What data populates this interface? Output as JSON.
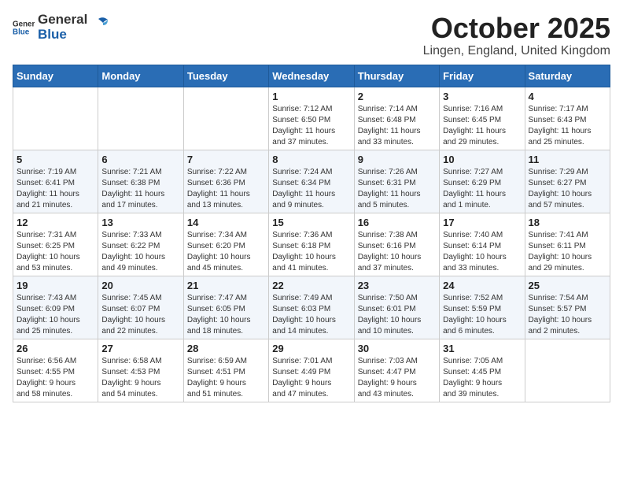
{
  "header": {
    "logo_general": "General",
    "logo_blue": "Blue",
    "month": "October 2025",
    "location": "Lingen, England, United Kingdom"
  },
  "weekdays": [
    "Sunday",
    "Monday",
    "Tuesday",
    "Wednesday",
    "Thursday",
    "Friday",
    "Saturday"
  ],
  "weeks": [
    [
      {
        "day": "",
        "info": ""
      },
      {
        "day": "",
        "info": ""
      },
      {
        "day": "",
        "info": ""
      },
      {
        "day": "1",
        "info": "Sunrise: 7:12 AM\nSunset: 6:50 PM\nDaylight: 11 hours\nand 37 minutes."
      },
      {
        "day": "2",
        "info": "Sunrise: 7:14 AM\nSunset: 6:48 PM\nDaylight: 11 hours\nand 33 minutes."
      },
      {
        "day": "3",
        "info": "Sunrise: 7:16 AM\nSunset: 6:45 PM\nDaylight: 11 hours\nand 29 minutes."
      },
      {
        "day": "4",
        "info": "Sunrise: 7:17 AM\nSunset: 6:43 PM\nDaylight: 11 hours\nand 25 minutes."
      }
    ],
    [
      {
        "day": "5",
        "info": "Sunrise: 7:19 AM\nSunset: 6:41 PM\nDaylight: 11 hours\nand 21 minutes."
      },
      {
        "day": "6",
        "info": "Sunrise: 7:21 AM\nSunset: 6:38 PM\nDaylight: 11 hours\nand 17 minutes."
      },
      {
        "day": "7",
        "info": "Sunrise: 7:22 AM\nSunset: 6:36 PM\nDaylight: 11 hours\nand 13 minutes."
      },
      {
        "day": "8",
        "info": "Sunrise: 7:24 AM\nSunset: 6:34 PM\nDaylight: 11 hours\nand 9 minutes."
      },
      {
        "day": "9",
        "info": "Sunrise: 7:26 AM\nSunset: 6:31 PM\nDaylight: 11 hours\nand 5 minutes."
      },
      {
        "day": "10",
        "info": "Sunrise: 7:27 AM\nSunset: 6:29 PM\nDaylight: 11 hours\nand 1 minute."
      },
      {
        "day": "11",
        "info": "Sunrise: 7:29 AM\nSunset: 6:27 PM\nDaylight: 10 hours\nand 57 minutes."
      }
    ],
    [
      {
        "day": "12",
        "info": "Sunrise: 7:31 AM\nSunset: 6:25 PM\nDaylight: 10 hours\nand 53 minutes."
      },
      {
        "day": "13",
        "info": "Sunrise: 7:33 AM\nSunset: 6:22 PM\nDaylight: 10 hours\nand 49 minutes."
      },
      {
        "day": "14",
        "info": "Sunrise: 7:34 AM\nSunset: 6:20 PM\nDaylight: 10 hours\nand 45 minutes."
      },
      {
        "day": "15",
        "info": "Sunrise: 7:36 AM\nSunset: 6:18 PM\nDaylight: 10 hours\nand 41 minutes."
      },
      {
        "day": "16",
        "info": "Sunrise: 7:38 AM\nSunset: 6:16 PM\nDaylight: 10 hours\nand 37 minutes."
      },
      {
        "day": "17",
        "info": "Sunrise: 7:40 AM\nSunset: 6:14 PM\nDaylight: 10 hours\nand 33 minutes."
      },
      {
        "day": "18",
        "info": "Sunrise: 7:41 AM\nSunset: 6:11 PM\nDaylight: 10 hours\nand 29 minutes."
      }
    ],
    [
      {
        "day": "19",
        "info": "Sunrise: 7:43 AM\nSunset: 6:09 PM\nDaylight: 10 hours\nand 25 minutes."
      },
      {
        "day": "20",
        "info": "Sunrise: 7:45 AM\nSunset: 6:07 PM\nDaylight: 10 hours\nand 22 minutes."
      },
      {
        "day": "21",
        "info": "Sunrise: 7:47 AM\nSunset: 6:05 PM\nDaylight: 10 hours\nand 18 minutes."
      },
      {
        "day": "22",
        "info": "Sunrise: 7:49 AM\nSunset: 6:03 PM\nDaylight: 10 hours\nand 14 minutes."
      },
      {
        "day": "23",
        "info": "Sunrise: 7:50 AM\nSunset: 6:01 PM\nDaylight: 10 hours\nand 10 minutes."
      },
      {
        "day": "24",
        "info": "Sunrise: 7:52 AM\nSunset: 5:59 PM\nDaylight: 10 hours\nand 6 minutes."
      },
      {
        "day": "25",
        "info": "Sunrise: 7:54 AM\nSunset: 5:57 PM\nDaylight: 10 hours\nand 2 minutes."
      }
    ],
    [
      {
        "day": "26",
        "info": "Sunrise: 6:56 AM\nSunset: 4:55 PM\nDaylight: 9 hours\nand 58 minutes."
      },
      {
        "day": "27",
        "info": "Sunrise: 6:58 AM\nSunset: 4:53 PM\nDaylight: 9 hours\nand 54 minutes."
      },
      {
        "day": "28",
        "info": "Sunrise: 6:59 AM\nSunset: 4:51 PM\nDaylight: 9 hours\nand 51 minutes."
      },
      {
        "day": "29",
        "info": "Sunrise: 7:01 AM\nSunset: 4:49 PM\nDaylight: 9 hours\nand 47 minutes."
      },
      {
        "day": "30",
        "info": "Sunrise: 7:03 AM\nSunset: 4:47 PM\nDaylight: 9 hours\nand 43 minutes."
      },
      {
        "day": "31",
        "info": "Sunrise: 7:05 AM\nSunset: 4:45 PM\nDaylight: 9 hours\nand 39 minutes."
      },
      {
        "day": "",
        "info": ""
      }
    ]
  ]
}
